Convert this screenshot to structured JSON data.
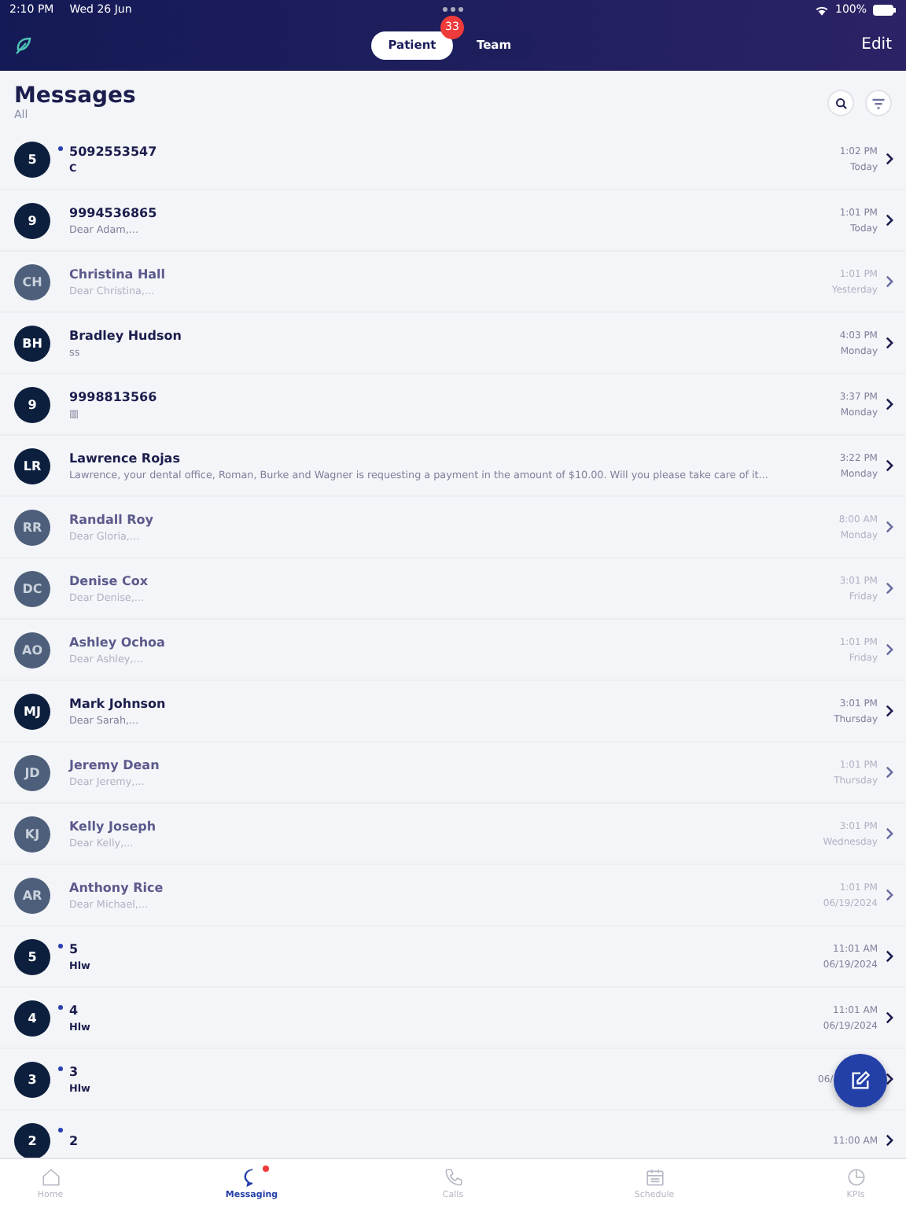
{
  "status_bar": {
    "time": "2:10 PM",
    "date": "Wed 26 Jun",
    "battery": "100%"
  },
  "header": {
    "tabs": [
      {
        "label": "Patient",
        "selected": true,
        "badge": "33"
      },
      {
        "label": "Team",
        "selected": false
      }
    ],
    "edit": "Edit"
  },
  "title": "Messages",
  "subtitle": "All",
  "messages": [
    {
      "initials": "5",
      "name": "5092553547",
      "preview": "C",
      "time": "1:02 PM",
      "date": "Today",
      "unread": true,
      "dimmed": false
    },
    {
      "initials": "9",
      "name": "9994536865",
      "preview": "Dear Adam,...",
      "time": "1:01 PM",
      "date": "Today",
      "unread": false,
      "dimmed": false
    },
    {
      "initials": "CH",
      "name": "Christina Hall",
      "preview": "Dear Christina,...",
      "time": "1:01 PM",
      "date": "Yesterday",
      "unread": false,
      "dimmed": true
    },
    {
      "initials": "BH",
      "name": "Bradley Hudson",
      "preview": "ss",
      "time": "4:03 PM",
      "date": "Monday",
      "unread": false,
      "dimmed": false
    },
    {
      "initials": "9",
      "name": "9998813566",
      "preview": "▥",
      "time": "3:37 PM",
      "date": "Monday",
      "unread": false,
      "dimmed": false
    },
    {
      "initials": "LR",
      "name": "Lawrence Rojas",
      "preview": "Lawrence, your dental office, Roman, Burke and Wagner is requesting a payment in the amount of $10.00. Will you please take care of it...",
      "time": "3:22 PM",
      "date": "Monday",
      "unread": false,
      "dimmed": false
    },
    {
      "initials": "RR",
      "name": "Randall Roy",
      "preview": "Dear Gloria,...",
      "time": "8:00 AM",
      "date": "Monday",
      "unread": false,
      "dimmed": true
    },
    {
      "initials": "DC",
      "name": "Denise Cox",
      "preview": "Dear Denise,...",
      "time": "3:01 PM",
      "date": "Friday",
      "unread": false,
      "dimmed": true
    },
    {
      "initials": "AO",
      "name": "Ashley Ochoa",
      "preview": "Dear Ashley,...",
      "time": "1:01 PM",
      "date": "Friday",
      "unread": false,
      "dimmed": true
    },
    {
      "initials": "MJ",
      "name": "Mark Johnson",
      "preview": "Dear Sarah,...",
      "time": "3:01 PM",
      "date": "Thursday",
      "unread": false,
      "dimmed": false
    },
    {
      "initials": "JD",
      "name": "Jeremy Dean",
      "preview": "Dear Jeremy,...",
      "time": "1:01 PM",
      "date": "Thursday",
      "unread": false,
      "dimmed": true
    },
    {
      "initials": "KJ",
      "name": "Kelly Joseph",
      "preview": "Dear Kelly,...",
      "time": "3:01 PM",
      "date": "Wednesday",
      "unread": false,
      "dimmed": true
    },
    {
      "initials": "AR",
      "name": "Anthony Rice",
      "preview": "Dear Michael,...",
      "time": "1:01 PM",
      "date": "06/19/2024",
      "unread": false,
      "dimmed": true
    },
    {
      "initials": "5",
      "name": "5",
      "preview": "Hlw",
      "time": "11:01 AM",
      "date": "06/19/2024",
      "unread": true,
      "dimmed": false
    },
    {
      "initials": "4",
      "name": "4",
      "preview": "Hlw",
      "time": "11:01 AM",
      "date": "06/19/2024",
      "unread": true,
      "dimmed": false
    },
    {
      "initials": "3",
      "name": "3",
      "preview": "Hlw",
      "date": "06/",
      "unread": true,
      "dimmed": false,
      "covered": true
    },
    {
      "initials": "2",
      "name": "2",
      "time": "11:00 AM",
      "unread": true,
      "dimmed": false
    }
  ],
  "nav": [
    {
      "label": "Home",
      "selected": false,
      "kind": "home"
    },
    {
      "label": "Messaging",
      "selected": true,
      "kind": "chat",
      "dot": true
    },
    {
      "label": "Calls",
      "selected": false,
      "kind": "phone"
    },
    {
      "label": "Schedule",
      "selected": false,
      "kind": "calendar"
    },
    {
      "label": "KPIs",
      "selected": false,
      "kind": "pie"
    }
  ]
}
